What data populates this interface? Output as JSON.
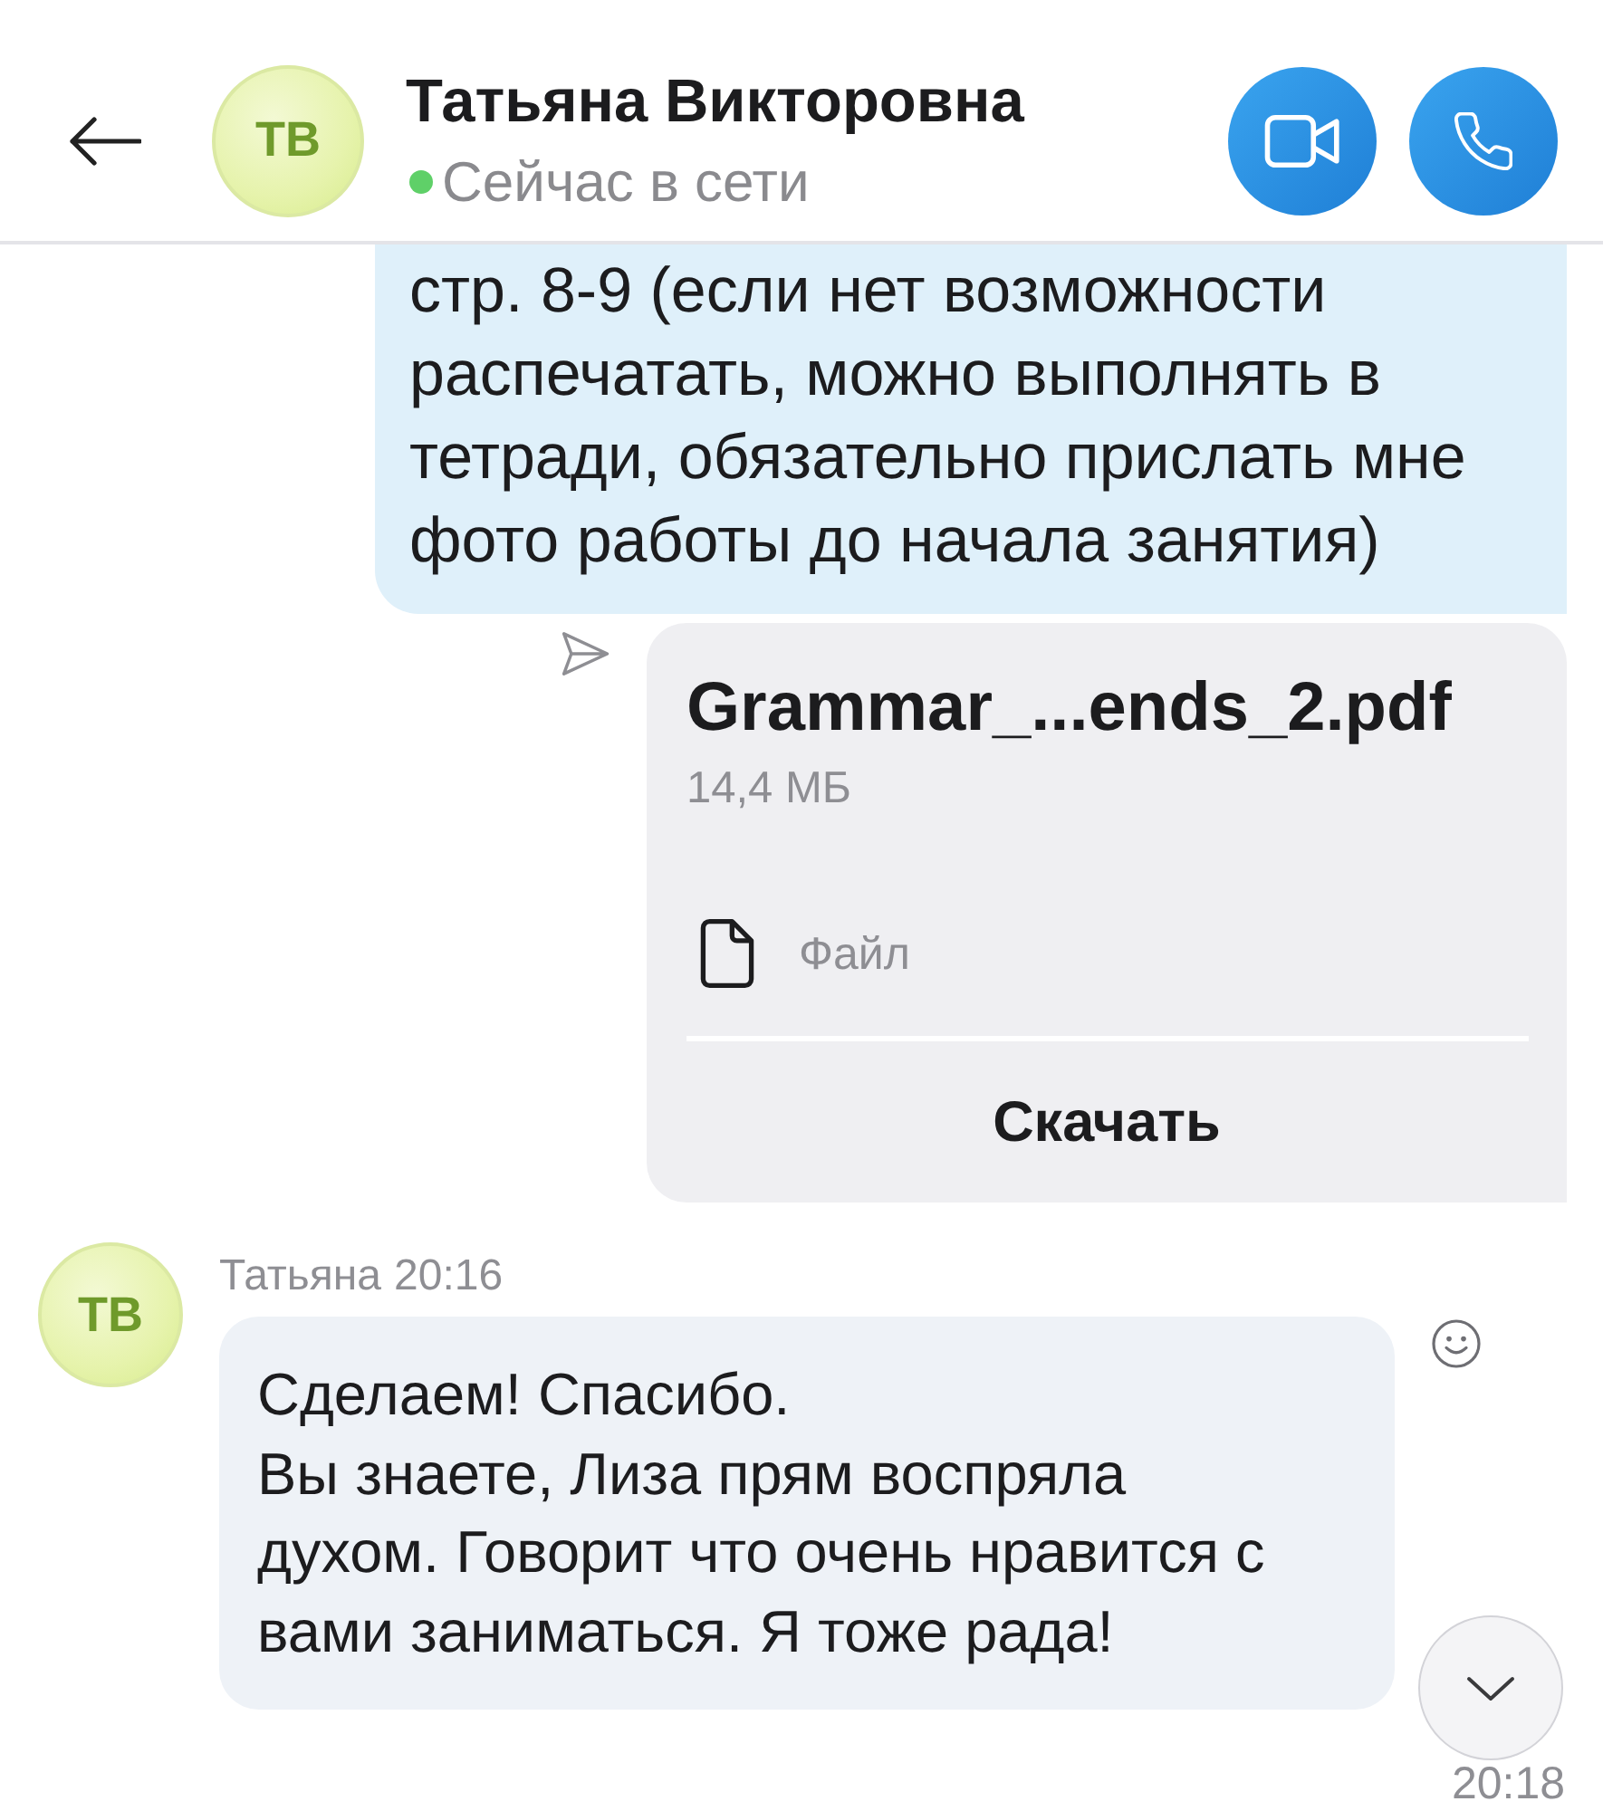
{
  "contact": {
    "initials": "ТВ",
    "name": "Татьяна Викторовна",
    "status": "Сейчас в сети",
    "online": true
  },
  "messages": [
    {
      "kind": "text",
      "outgoing": true,
      "text": "стр. 8-9 (если нет возможности распечатать, можно выполнять в тетради, обязательно прислать мне фото работы до начала занятия)"
    },
    {
      "kind": "file",
      "outgoing": true,
      "sent": true,
      "file_name": "Grammar_...ends_2.pdf",
      "size": "14,4 МБ",
      "type_label": "Файл",
      "action": "Скачать"
    },
    {
      "kind": "text",
      "outgoing": false,
      "initials": "ТВ",
      "sender": "Татьяна",
      "time": "20:16",
      "text": "Сделаем! Спасибо.\nВы знаете, Лиза прям воспряла духом. Говорит что очень нравится с вами заниматься. Я тоже рада!"
    }
  ],
  "bottom_time": "20:18"
}
